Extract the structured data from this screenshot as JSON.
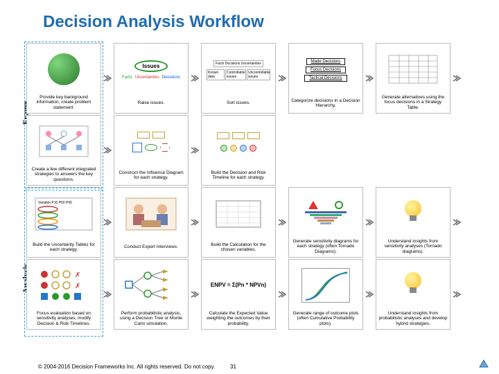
{
  "title": "Decision Analysis Workflow",
  "sections": {
    "frame": "Frame",
    "analysis": "Analysis"
  },
  "footer": "© 2004-2016 Decision Frameworks Inc. All rights reserved. Do not copy.",
  "page": "31",
  "row1": {
    "c1": {
      "caption": "Provide key background information, create problem statement."
    },
    "c2": {
      "banner": "Issues",
      "a": "Facts",
      "b": "Uncertainties",
      "c": "Decisions",
      "caption": "Raise issues."
    },
    "c3": {
      "hdr": "Facts   Decisions   Uncertainties",
      "col1": "Known data",
      "col2": "Controllable issues",
      "col3": "Uncontrollable issues",
      "caption": "Sort issues."
    },
    "c4": {
      "l1": "Made Decisions",
      "l2": "Focus Decisions",
      "l3": "Tactical Decisions",
      "caption": "Categorize decisions in a Decision Hierarchy."
    },
    "c5": {
      "caption": "Generate alternatives using the focus decisions in a Strategy Table."
    }
  },
  "row2": {
    "c1": {
      "caption": "Create a few different integrated strategies to answers the key questions."
    },
    "c2": {
      "caption": "Construct the Influence Diagram for each strategy."
    },
    "c3": {
      "caption": "Build the Decision and Risk Timeline for each strategy."
    }
  },
  "row3": {
    "c1": {
      "hdr": "Variable   P10   P50   P90",
      "caption": "Build the Uncertainty Tables for each strategy."
    },
    "c2": {
      "caption": "Conduct Expert Interviews."
    },
    "c3": {
      "caption": "Build the Calculation for the chosen variables."
    },
    "c4": {
      "caption": "Generate sensitivity diagrams for each strategy (often Tornado Diagrams)."
    },
    "c5": {
      "caption": "Understand insights from sensitivity analyses (Tornado diagrams)."
    }
  },
  "row4": {
    "c1": {
      "caption": "Focus evaluation based on sensitivity analyses, modify Decision & Risk Timelines."
    },
    "c2": {
      "caption": "Perform probabilistic analysis, using a Decision Tree or Monte Carlo simulation."
    },
    "c3": {
      "formula": "ENPV = Σ(Pn * NPVn)",
      "caption": "Calculate the Expected Value weighting the outcomes by their probability."
    },
    "c4": {
      "caption": "Generate range of outcome plots (often Cumulative Probability plots)."
    },
    "c5": {
      "caption": "Understand insights from probabilistic analyses and develop hybrid strategies."
    }
  }
}
